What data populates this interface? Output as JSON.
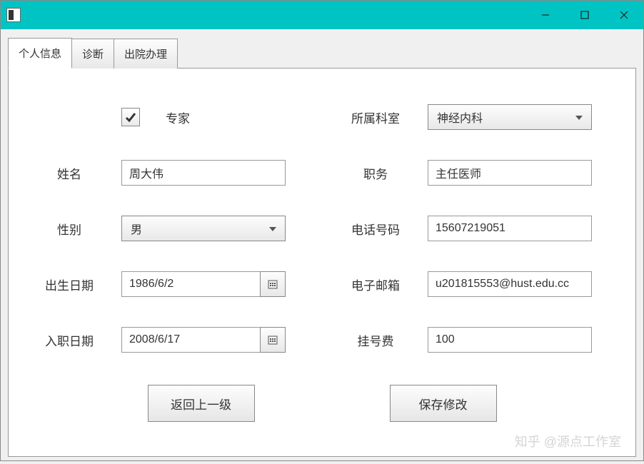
{
  "tabs": {
    "personal": "个人信息",
    "diagnosis": "诊断",
    "discharge": "出院办理"
  },
  "form": {
    "expert_checked": true,
    "expert_label": "专家",
    "department_label": "所属科室",
    "department_value": "神经内科",
    "name_label": "姓名",
    "name_value": "周大伟",
    "position_label": "职务",
    "position_value": "主任医师",
    "gender_label": "性别",
    "gender_value": "男",
    "phone_label": "电话号码",
    "phone_value": "15607219051",
    "birth_label": "出生日期",
    "birth_value": "1986/6/2",
    "email_label": "电子邮箱",
    "email_value": "u201815553@hust.edu.cc",
    "hire_label": "入职日期",
    "hire_value": "2008/6/17",
    "fee_label": "挂号费",
    "fee_value": "100"
  },
  "buttons": {
    "back": "返回上一级",
    "save": "保存修改"
  },
  "watermark": "知乎 @源点工作室"
}
